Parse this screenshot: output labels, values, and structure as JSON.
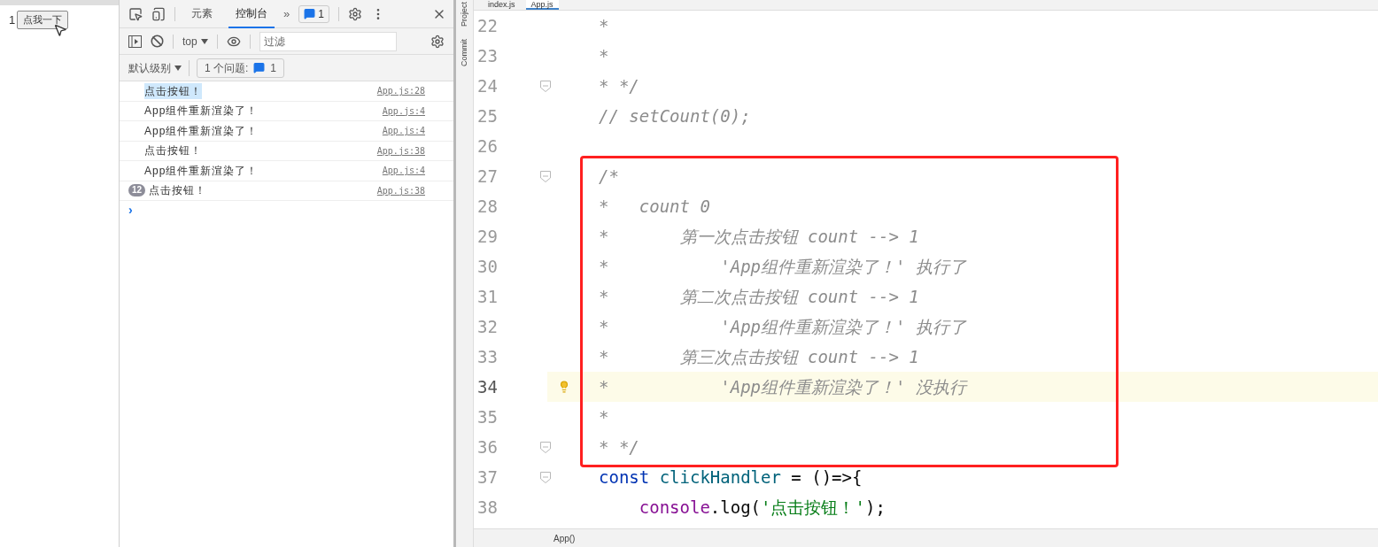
{
  "browser_page": {
    "count": "1",
    "button": "点我一下"
  },
  "devtools": {
    "tabs": [
      {
        "label": "元素",
        "selected": false
      },
      {
        "label": "控制台",
        "selected": true
      }
    ],
    "more": "»",
    "issues_badge": "1",
    "context": "top",
    "filter_placeholder": "过滤",
    "level_filter": "默认级别",
    "issues_label": "1 个问题:",
    "issues_count": "1",
    "messages": [
      {
        "text": "点击按钮！",
        "source": "App.js:28",
        "selected": true
      },
      {
        "text": "App组件重新渲染了！",
        "source": "App.js:4",
        "selected": false
      },
      {
        "text": "App组件重新渲染了！",
        "source": "App.js:4",
        "selected": false
      },
      {
        "text": "点击按钮！",
        "source": "App.js:38",
        "selected": false
      },
      {
        "text": "App组件重新渲染了！",
        "source": "App.js:4",
        "selected": false
      },
      {
        "text": "点击按钮！",
        "source": "App.js:38",
        "selected": false,
        "repeat": "12"
      }
    ],
    "prompt": "›"
  },
  "editor": {
    "tabs": [
      {
        "label": "index.js",
        "selected": false
      },
      {
        "label": "App.js",
        "selected": true
      }
    ],
    "side_tabs": [
      "Project",
      "Commit"
    ],
    "lines": [
      {
        "number": "22",
        "fold": false,
        "current": false,
        "tokens": [
          {
            "text": "*",
            "kind": "comment"
          }
        ]
      },
      {
        "number": "23",
        "fold": false,
        "current": false,
        "tokens": [
          {
            "text": "*",
            "kind": "comment"
          }
        ]
      },
      {
        "number": "24",
        "fold": true,
        "current": false,
        "tokens": [
          {
            "text": "* */",
            "kind": "comment"
          }
        ]
      },
      {
        "number": "25",
        "fold": false,
        "current": false,
        "tokens": [
          {
            "text": "// setCount(0);",
            "kind": "comment"
          }
        ]
      },
      {
        "number": "26",
        "fold": false,
        "current": false
      },
      {
        "number": "27",
        "fold": true,
        "current": false,
        "tokens": [
          {
            "text": "/*",
            "kind": "comment"
          }
        ]
      },
      {
        "number": "28",
        "fold": false,
        "current": false,
        "tokens": [
          {
            "text": "*   count 0",
            "kind": "comment"
          }
        ]
      },
      {
        "number": "29",
        "fold": false,
        "current": false,
        "tokens": [
          {
            "text": "*       第一次点击按钮 count --> 1",
            "kind": "comment"
          }
        ]
      },
      {
        "number": "30",
        "fold": false,
        "current": false,
        "tokens": [
          {
            "text": "*           'App组件重新渲染了！' 执行了",
            "kind": "comment"
          }
        ]
      },
      {
        "number": "31",
        "fold": false,
        "current": false,
        "tokens": [
          {
            "text": "*       第二次点击按钮 count --> 1",
            "kind": "comment"
          }
        ]
      },
      {
        "number": "32",
        "fold": false,
        "current": false,
        "tokens": [
          {
            "text": "*           'App组件重新渲染了！' 执行了",
            "kind": "comment"
          }
        ]
      },
      {
        "number": "33",
        "fold": false,
        "current": false,
        "tokens": [
          {
            "text": "*       第三次点击按钮 count --> 1",
            "kind": "comment"
          }
        ]
      },
      {
        "number": "34",
        "fold": false,
        "current": true,
        "tokens": [
          {
            "text": "*           'App组件重新渲染了！' 没执行",
            "kind": "comment"
          }
        ]
      },
      {
        "number": "35",
        "fold": false,
        "current": false,
        "tokens": [
          {
            "text": "*",
            "kind": "comment"
          }
        ]
      },
      {
        "number": "36",
        "fold": true,
        "current": false,
        "tokens": [
          {
            "text": "* */",
            "kind": "comment"
          }
        ]
      },
      {
        "number": "37",
        "fold": true,
        "current": false,
        "tokens": [
          {
            "text": "const",
            "kind": "keyword"
          },
          {
            "text": " clickHandler",
            "kind": "function"
          },
          {
            "text": " = ()=>{",
            "kind": "plain"
          }
        ]
      },
      {
        "number": "38",
        "fold": false,
        "current": false,
        "tokens": [
          {
            "text": "    console",
            "kind": "object"
          },
          {
            "text": ".log(",
            "kind": "plain"
          },
          {
            "text": "'点击按钮！'",
            "kind": "string"
          },
          {
            "text": ");",
            "kind": "plain"
          }
        ]
      }
    ],
    "breadcrumb": "App()"
  }
}
